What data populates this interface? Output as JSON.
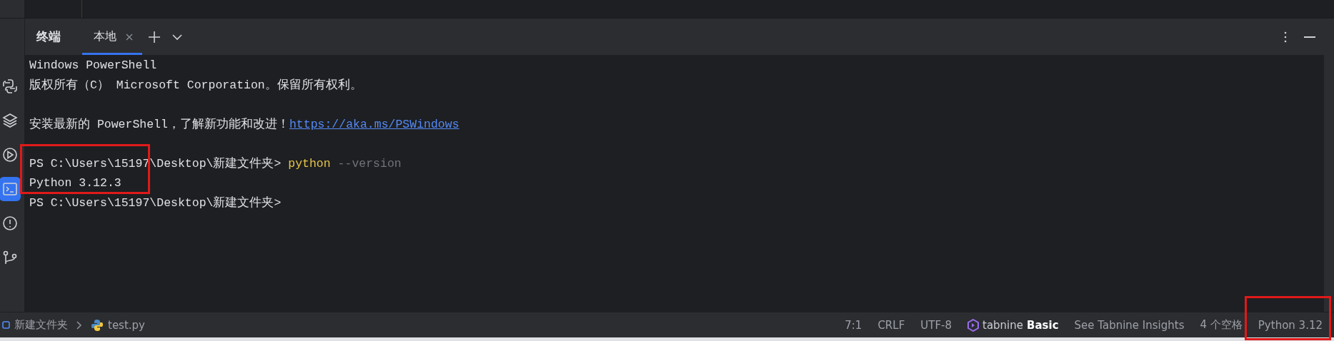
{
  "tool_window": {
    "title": "终端",
    "tabs": [
      {
        "label": "本地",
        "selected": true,
        "closable": true
      }
    ]
  },
  "sidebar": {
    "items": [
      {
        "kind": "python",
        "selected": false
      },
      {
        "kind": "layers",
        "selected": false
      },
      {
        "kind": "run",
        "selected": false
      },
      {
        "kind": "terminal",
        "selected": true
      },
      {
        "kind": "problems",
        "selected": false
      },
      {
        "kind": "git",
        "selected": false
      }
    ]
  },
  "terminal": {
    "highlighted": true,
    "lines": [
      {
        "kind": "output",
        "segments": [
          {
            "kind": "text",
            "text": "Windows PowerShell"
          }
        ]
      },
      {
        "kind": "output",
        "segments": [
          {
            "kind": "text",
            "text": "版权所有（C） Microsoft Corporation。保留所有权利。"
          }
        ]
      },
      {
        "kind": "blank"
      },
      {
        "kind": "output",
        "segments": [
          {
            "kind": "text",
            "text": "安装最新的 PowerShell，了解新功能和改进！"
          },
          {
            "kind": "link",
            "text": "https://aka.ms/PSWindows"
          }
        ]
      },
      {
        "kind": "blank"
      },
      {
        "kind": "output",
        "segments": [
          {
            "kind": "text",
            "text": "PS C:\\Users\\15197\\Desktop\\新建文件夹> "
          },
          {
            "kind": "command",
            "text": "python"
          },
          {
            "kind": "argument",
            "text": " --version"
          }
        ]
      },
      {
        "kind": "output",
        "segments": [
          {
            "kind": "text",
            "text": "Python 3.12.3"
          }
        ]
      },
      {
        "kind": "output",
        "segments": [
          {
            "kind": "text",
            "text": "PS C:\\Users\\15197\\Desktop\\新建文件夹>"
          }
        ]
      }
    ]
  },
  "status_bar": {
    "highlighted": true,
    "breadcrumbs": [
      {
        "kind": "folder",
        "text": "新建文件夹"
      },
      {
        "kind": "python-file",
        "text": "test.py"
      }
    ],
    "items": [
      {
        "kind": "text",
        "text": "7:1"
      },
      {
        "kind": "text",
        "text": "CRLF"
      },
      {
        "kind": "text",
        "text": "UTF-8"
      },
      {
        "kind": "tabnine",
        "text": "tabnine",
        "badge": "Basic"
      },
      {
        "kind": "text",
        "text": "See Tabnine Insights"
      },
      {
        "kind": "text",
        "text": "4 个空格"
      },
      {
        "kind": "text",
        "text": "Python 3.12"
      }
    ]
  }
}
